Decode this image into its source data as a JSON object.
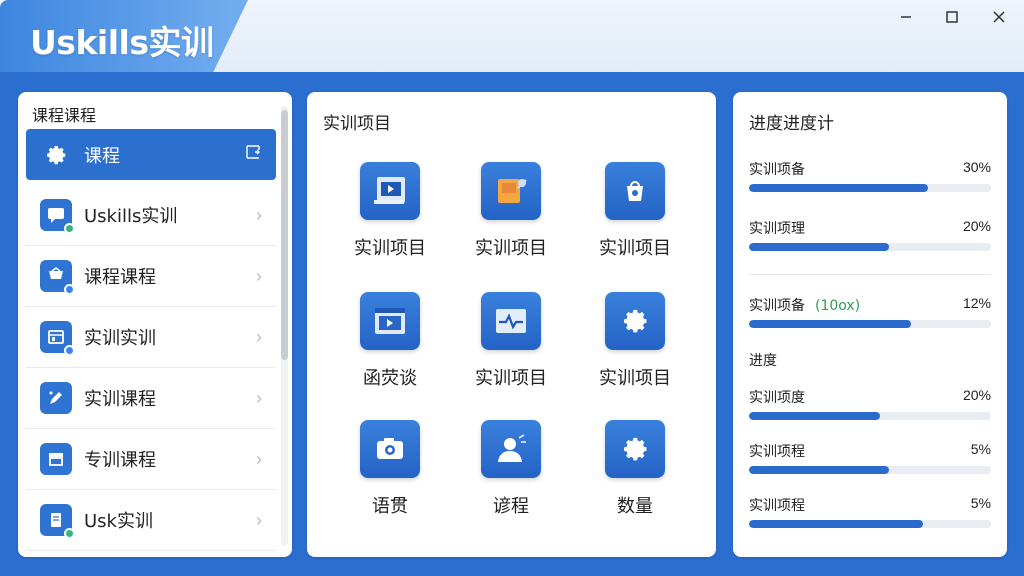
{
  "window": {
    "brand": "Uskills实训",
    "controls": [
      "minimize-icon",
      "maximize-icon",
      "close-icon"
    ]
  },
  "sidebar": {
    "title": "课程课程",
    "items": [
      {
        "label": "课程",
        "icon": "gear-icon",
        "active": true
      },
      {
        "label": "Uskills实训",
        "icon": "chat-icon"
      },
      {
        "label": "课程课程",
        "icon": "cart-icon"
      },
      {
        "label": "实训实训",
        "icon": "store-icon"
      },
      {
        "label": "实训课程",
        "icon": "edit-icon"
      },
      {
        "label": "专训课程",
        "icon": "shop-icon"
      },
      {
        "label": "Usk实训",
        "icon": "document-icon"
      }
    ]
  },
  "projects": {
    "title": "实训项目",
    "tiles": [
      {
        "label": "实训项目",
        "icon": "video-icon"
      },
      {
        "label": "实训项目",
        "icon": "puzzle-icon"
      },
      {
        "label": "实训项目",
        "icon": "bag-icon"
      },
      {
        "label": "函荧谈",
        "icon": "media-window-icon"
      },
      {
        "label": "实训项目",
        "icon": "pulse-icon"
      },
      {
        "label": "实训项目",
        "icon": "gear-icon"
      },
      {
        "label": "语贯",
        "icon": "camera-icon"
      },
      {
        "label": "谚程",
        "icon": "user-icon"
      },
      {
        "label": "数量",
        "icon": "gear-icon"
      }
    ]
  },
  "progress": {
    "title": "进度进度计",
    "group1": [
      {
        "label": "实训项备",
        "value": "30%",
        "fill": 0.74
      },
      {
        "label": "实训项理",
        "value": "20%",
        "fill": 0.58
      }
    ],
    "group2": [
      {
        "label": "实训项备",
        "note": "(10ox)",
        "value": "12%",
        "fill": 0.67
      }
    ],
    "section_label": "进度",
    "group3": [
      {
        "label": "实训项度",
        "value": "20%",
        "fill": 0.54
      },
      {
        "label": "实训项程",
        "value": "5%",
        "fill": 0.58
      },
      {
        "label": "实训项程",
        "value": "5%",
        "fill": 0.72
      }
    ]
  },
  "colors": {
    "accent": "#2a6fd0",
    "bar_fill": "#2a6bcd",
    "note_green": "#2e9b4e"
  }
}
